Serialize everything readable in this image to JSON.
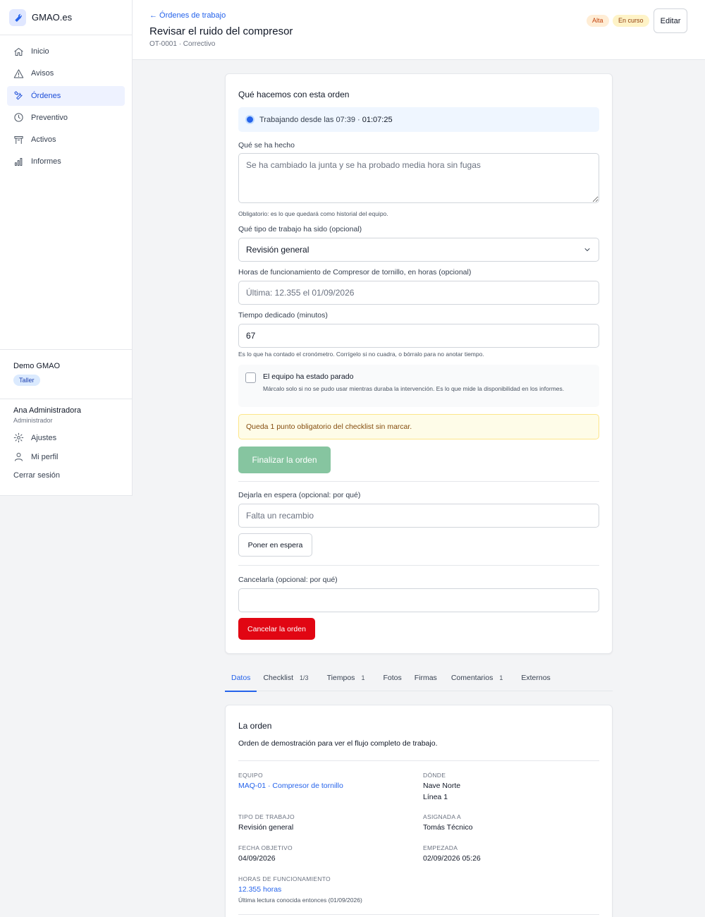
{
  "app": {
    "name": "GMAO.es"
  },
  "sidebar": {
    "items": [
      {
        "label": "Inicio",
        "icon": "home-icon",
        "active": false
      },
      {
        "label": "Avisos",
        "icon": "warning-icon",
        "active": false
      },
      {
        "label": "Órdenes",
        "icon": "wrench-icon",
        "active": true
      },
      {
        "label": "Preventivo",
        "icon": "clock-icon",
        "active": false
      },
      {
        "label": "Activos",
        "icon": "asset-icon",
        "active": false
      },
      {
        "label": "Informes",
        "icon": "chart-icon",
        "active": false
      }
    ],
    "org": {
      "name": "Demo GMAO",
      "badge": "Taller"
    },
    "user": {
      "name": "Ana Administradora",
      "role": "Administrador"
    },
    "settings_label": "Ajustes",
    "profile_label": "Mi perfil",
    "logout_label": "Cerrar sesión"
  },
  "header": {
    "back_label": "← Órdenes de trabajo",
    "title": "Revisar el ruido del compresor",
    "subtitle": "OT-0001 · Correctivo",
    "priority_badge": "Alta",
    "status_badge": "En curso",
    "edit_label": "Editar"
  },
  "action": {
    "title": "Qué hacemos con esta orden",
    "timer_text": "Trabajando desde las 07:39 · ",
    "timer_elapsed": "01:07:25",
    "done_label": "Qué se ha hecho",
    "done_placeholder": "Se ha cambiado la junta y se ha probado media hora sin fugas",
    "done_help": "Obligatorio: es lo que quedará como historial del equipo.",
    "work_type_label": "Qué tipo de trabajo ha sido (opcional)",
    "work_type_value": "Revisión general",
    "hours_label": "Horas de funcionamiento de Compresor de tornillo, en horas (opcional)",
    "hours_placeholder": "Última: 12.355 el 01/09/2026",
    "time_label": "Tiempo dedicado (minutos)",
    "time_value": "67",
    "time_help": "Es lo que ha contado el cronómetro. Corrígelo si no cuadra, o bórralo para no anotar tiempo.",
    "downtime_label": "El equipo ha estado parado",
    "downtime_help": "Márcalo solo si no se pudo usar mientras duraba la intervención. Es lo que mide la disponibilidad en los informes.",
    "warning": "Queda 1 punto obligatorio del checklist sin marcar.",
    "finish_label": "Finalizar la orden",
    "wait_label": "Dejarla en espera (opcional: por qué)",
    "wait_placeholder": "Falta un recambio",
    "wait_button": "Poner en espera",
    "cancel_label": "Cancelarla (opcional: por qué)",
    "cancel_placeholder": "",
    "cancel_button": "Cancelar la orden"
  },
  "tabs": [
    {
      "label": "Datos",
      "count": "",
      "active": true
    },
    {
      "label": "Checklist",
      "count": "1/3",
      "active": false
    },
    {
      "label": "Tiempos",
      "count": "1",
      "active": false
    },
    {
      "label": "Fotos",
      "count": "",
      "active": false
    },
    {
      "label": "Firmas",
      "count": "",
      "active": false
    },
    {
      "label": "Comentarios",
      "count": "1",
      "active": false
    },
    {
      "label": "Externos",
      "count": "",
      "active": false
    }
  ],
  "info": {
    "title": "La orden",
    "description": "Orden de demostración para ver el flujo completo de trabajo.",
    "equipo_key": "Equipo",
    "equipo_value": "MAQ-01 · Compresor de tornillo",
    "donde_key": "Dónde",
    "donde_line1": "Nave Norte",
    "donde_line2": "Línea 1",
    "tipo_key": "Tipo de trabajo",
    "tipo_value": "Revisión general",
    "asignada_key": "Asignada a",
    "asignada_value": "Tomás Técnico",
    "fecha_key": "Fecha objetivo",
    "fecha_value": "04/09/2026",
    "empezada_key": "Empezada",
    "empezada_value": "02/09/2026 05:26",
    "horas_key": "Horas de funcionamiento",
    "horas_value": "12.355 horas",
    "horas_note": "Última lectura conocida entonces (01/09/2026)"
  },
  "colors": {
    "accent": "#2563eb",
    "success_disabled": "#86c5a0",
    "danger": "#e10613"
  }
}
